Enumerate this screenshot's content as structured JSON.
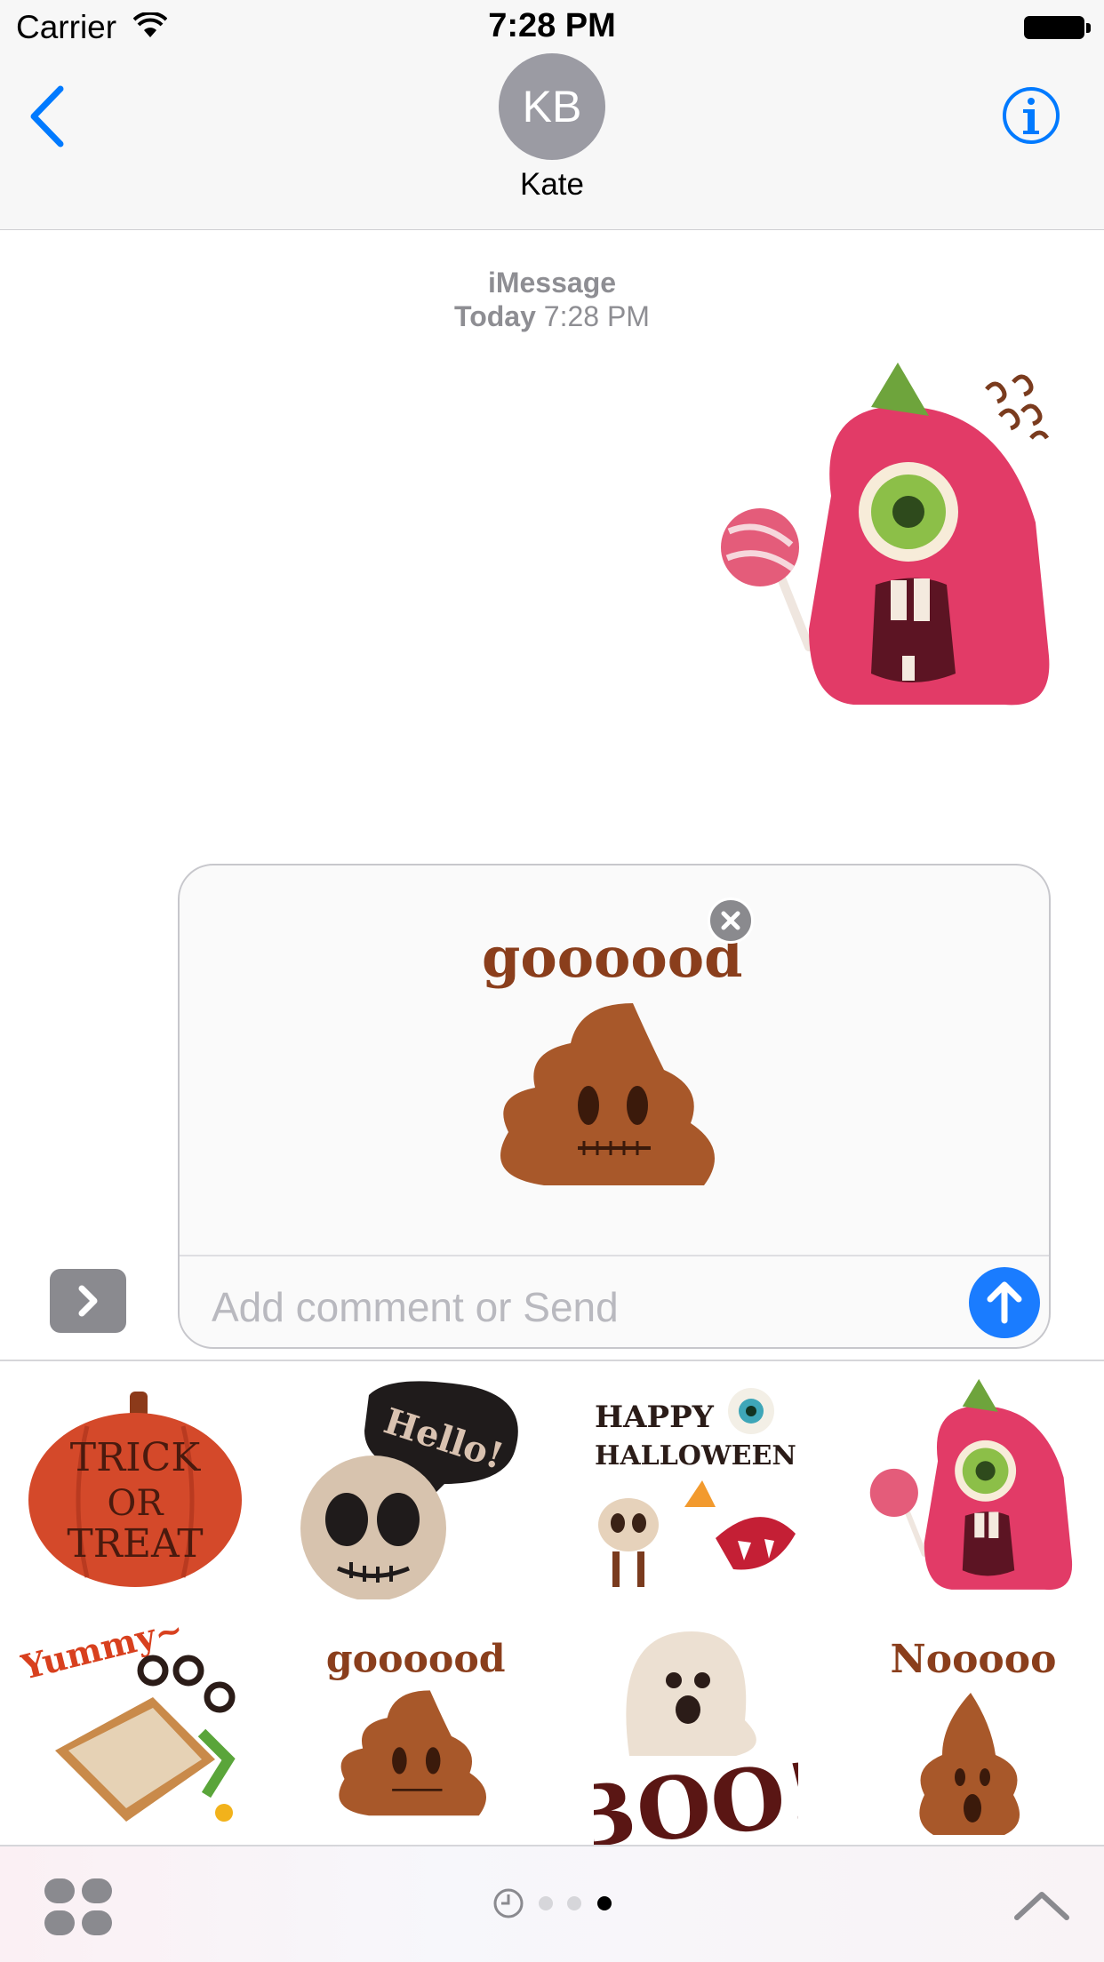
{
  "status_bar": {
    "carrier": "Carrier",
    "time": "7:28 PM"
  },
  "nav": {
    "avatar_initials": "KB",
    "contact_name": "Kate"
  },
  "conversation": {
    "service": "iMessage",
    "day": "Today",
    "time": "7:28 PM"
  },
  "compose": {
    "placeholder": "Add comment or Send",
    "staged_sticker_text": "goooood"
  },
  "stickers": [
    {
      "name": "trick-or-treat-pumpkin",
      "lines": [
        "TRICK",
        "OR",
        "TREAT"
      ]
    },
    {
      "name": "skull-hello",
      "text": "Hello!"
    },
    {
      "name": "happy-halloween",
      "lines": [
        "HAPPY",
        "HALLOWEEN"
      ]
    },
    {
      "name": "pink-cyclops-monster"
    },
    {
      "name": "yummy-sandwich",
      "text": "Yummy~"
    },
    {
      "name": "goooood-poop",
      "text": "goooood"
    },
    {
      "name": "boo-ghost",
      "text": "BOO!"
    },
    {
      "name": "nooooo-poop",
      "text": "Nooooo"
    }
  ],
  "colors": {
    "accent": "#007aff",
    "send": "#1a7cff",
    "monster": "#e23b67",
    "poop": "#a8582a"
  }
}
